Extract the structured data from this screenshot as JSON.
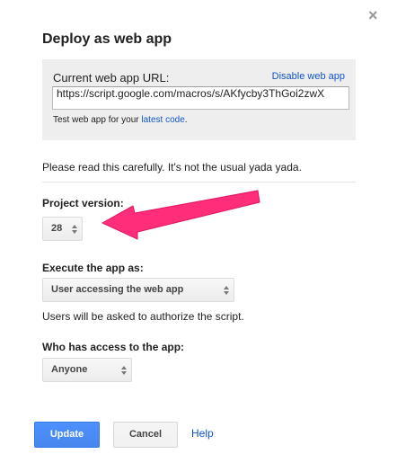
{
  "dialog": {
    "title": "Deploy as web app",
    "close_icon": "close-icon"
  },
  "url_section": {
    "label": "Current web app URL:",
    "disable_link": "Disable web app",
    "url_value": "https://script.google.com/macros/s/AKfycby3ThGoi2zwX",
    "test_prefix": "Test web app for your ",
    "test_link": "latest code",
    "test_suffix": "."
  },
  "warning": "Please read this carefully. It's not the usual yada yada.",
  "project_version": {
    "label": "Project version:",
    "value": "28"
  },
  "execute_as": {
    "label": "Execute the app as:",
    "value": "User accessing the web app",
    "help": "Users will be asked to authorize the script."
  },
  "access": {
    "label": "Who has access to the app:",
    "value": "Anyone"
  },
  "buttons": {
    "update": "Update",
    "cancel": "Cancel",
    "help": "Help"
  },
  "colors": {
    "accent": "#4d90fe",
    "link": "#1155cc",
    "annotation_arrow": "#ff2d7a"
  }
}
